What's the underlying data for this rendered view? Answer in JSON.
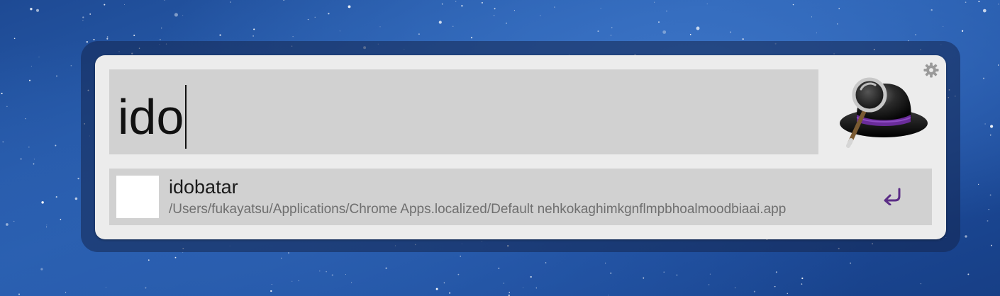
{
  "search": {
    "query": "ido"
  },
  "icons": {
    "settings": "gear-icon",
    "logo": "alfred-hat-icon",
    "result_icon": "app-icon",
    "action": "return-arrow-icon"
  },
  "results": [
    {
      "title": "idobatar",
      "subtitle": "/Users/fukayatsu/Applications/Chrome Apps.localized/Default nehkokaghimkgnflmpbhoalmoodbiaai.app"
    }
  ],
  "colors": {
    "panel": "#ececec",
    "field": "#d1d1d1",
    "accent": "#5b2d86",
    "subtitle": "#6f6f6f"
  }
}
